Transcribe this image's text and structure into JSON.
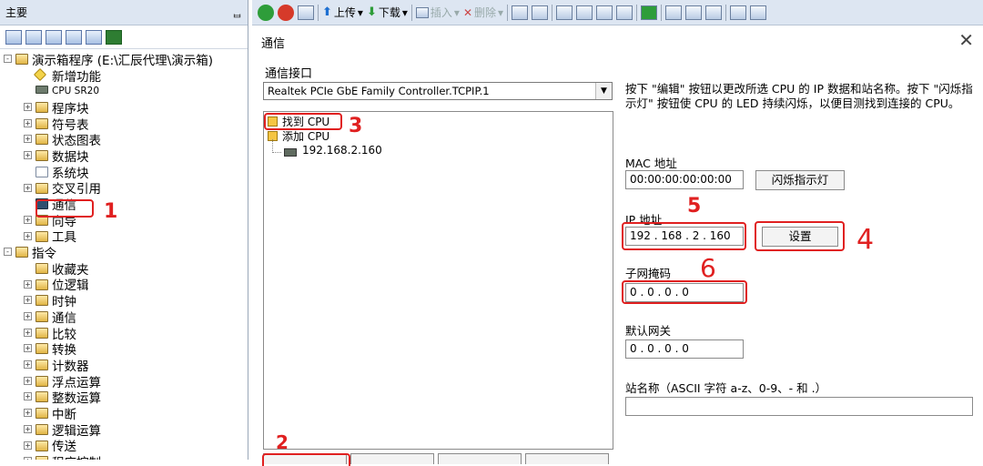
{
  "left_panel": {
    "title": "主要",
    "pin_icon": "pin-icon",
    "tree": [
      {
        "label": "演示箱程序 (E:\\汇辰代理\\演示箱)",
        "level": 0,
        "icon": "project-icon",
        "expander": "-"
      },
      {
        "label": "新增功能",
        "level": 1,
        "icon": "star-icon",
        "expander": ""
      },
      {
        "label": "CPU SR20",
        "level": 1,
        "icon": "plc-icon",
        "expander": ""
      },
      {
        "label": "程序块",
        "level": 1,
        "icon": "folder-icon",
        "expander": "+"
      },
      {
        "label": "符号表",
        "level": 1,
        "icon": "folder-icon",
        "expander": "+"
      },
      {
        "label": "状态图表",
        "level": 1,
        "icon": "folder-icon",
        "expander": "+"
      },
      {
        "label": "数据块",
        "level": 1,
        "icon": "folder-icon",
        "expander": "+"
      },
      {
        "label": "系统块",
        "level": 1,
        "icon": "doc-icon",
        "expander": ""
      },
      {
        "label": "交叉引用",
        "level": 1,
        "icon": "folder-icon",
        "expander": "+"
      },
      {
        "label": "通信",
        "level": 1,
        "icon": "comm-icon",
        "expander": ""
      },
      {
        "label": "向导",
        "level": 1,
        "icon": "wizard-icon",
        "expander": "+"
      },
      {
        "label": "工具",
        "level": 1,
        "icon": "folder-icon",
        "expander": "+"
      },
      {
        "label": "指令",
        "level": 0,
        "icon": "folder-icon",
        "expander": "-"
      },
      {
        "label": "收藏夹",
        "level": 1,
        "icon": "folder-icon",
        "expander": ""
      },
      {
        "label": "位逻辑",
        "level": 1,
        "icon": "folder-icon",
        "expander": "+"
      },
      {
        "label": "时钟",
        "level": 1,
        "icon": "folder-icon",
        "expander": "+"
      },
      {
        "label": "通信",
        "level": 1,
        "icon": "folder-icon",
        "expander": "+"
      },
      {
        "label": "比较",
        "level": 1,
        "icon": "folder-icon",
        "expander": "+"
      },
      {
        "label": "转换",
        "level": 1,
        "icon": "folder-icon",
        "expander": "+"
      },
      {
        "label": "计数器",
        "level": 1,
        "icon": "folder-icon",
        "expander": "+"
      },
      {
        "label": "浮点运算",
        "level": 1,
        "icon": "folder-icon",
        "expander": "+"
      },
      {
        "label": "整数运算",
        "level": 1,
        "icon": "folder-icon",
        "expander": "+"
      },
      {
        "label": "中断",
        "level": 1,
        "icon": "folder-icon",
        "expander": "+"
      },
      {
        "label": "逻辑运算",
        "level": 1,
        "icon": "folder-icon",
        "expander": "+"
      },
      {
        "label": "传送",
        "level": 1,
        "icon": "folder-icon",
        "expander": "+"
      },
      {
        "label": "程序控制",
        "level": 1,
        "icon": "folder-icon",
        "expander": "+"
      }
    ]
  },
  "toolbar": {
    "upload_label": "上传",
    "download_label": "下载",
    "insert_label": "插入",
    "delete_label": "删除"
  },
  "dialog": {
    "title": "通信",
    "close_icon": "close-icon",
    "interface_label": "通信接口",
    "interface_value": "Realtek PCIe GbE Family Controller.TCPIP.1",
    "cpu_tree": {
      "find_cpu": "找到 CPU",
      "add_cpu": "添加 CPU",
      "cpu_ip": "192.168.2.160"
    },
    "hint": "按下 \"编辑\" 按钮以更改所选 CPU 的 IP 数据和站名称。按下 \"闪烁指示灯\" 按钮使 CPU 的 LED 持续闪烁，以便目测找到连接的 CPU。",
    "mac_label": "MAC 地址",
    "mac_value": "00:00:00:00:00:00",
    "blink_button": "闪烁指示灯",
    "ip_label": "IP 地址",
    "ip_value": "192 . 168 .  2  . 160",
    "set_button": "设置",
    "subnet_label": "子网掩码",
    "subnet_value": "0  .  0  .  0  .  0",
    "gateway_label": "默认网关",
    "gateway_value": "0  .  0  .  0  .  0",
    "station_label": "站名称（ASCII 字符 a-z、0-9、- 和 .）",
    "station_value": ""
  },
  "annotations": {
    "n1": "1",
    "n2": "2",
    "n3": "3",
    "n4": "4",
    "n5": "5",
    "n6": "6",
    "color": "#e02020"
  }
}
